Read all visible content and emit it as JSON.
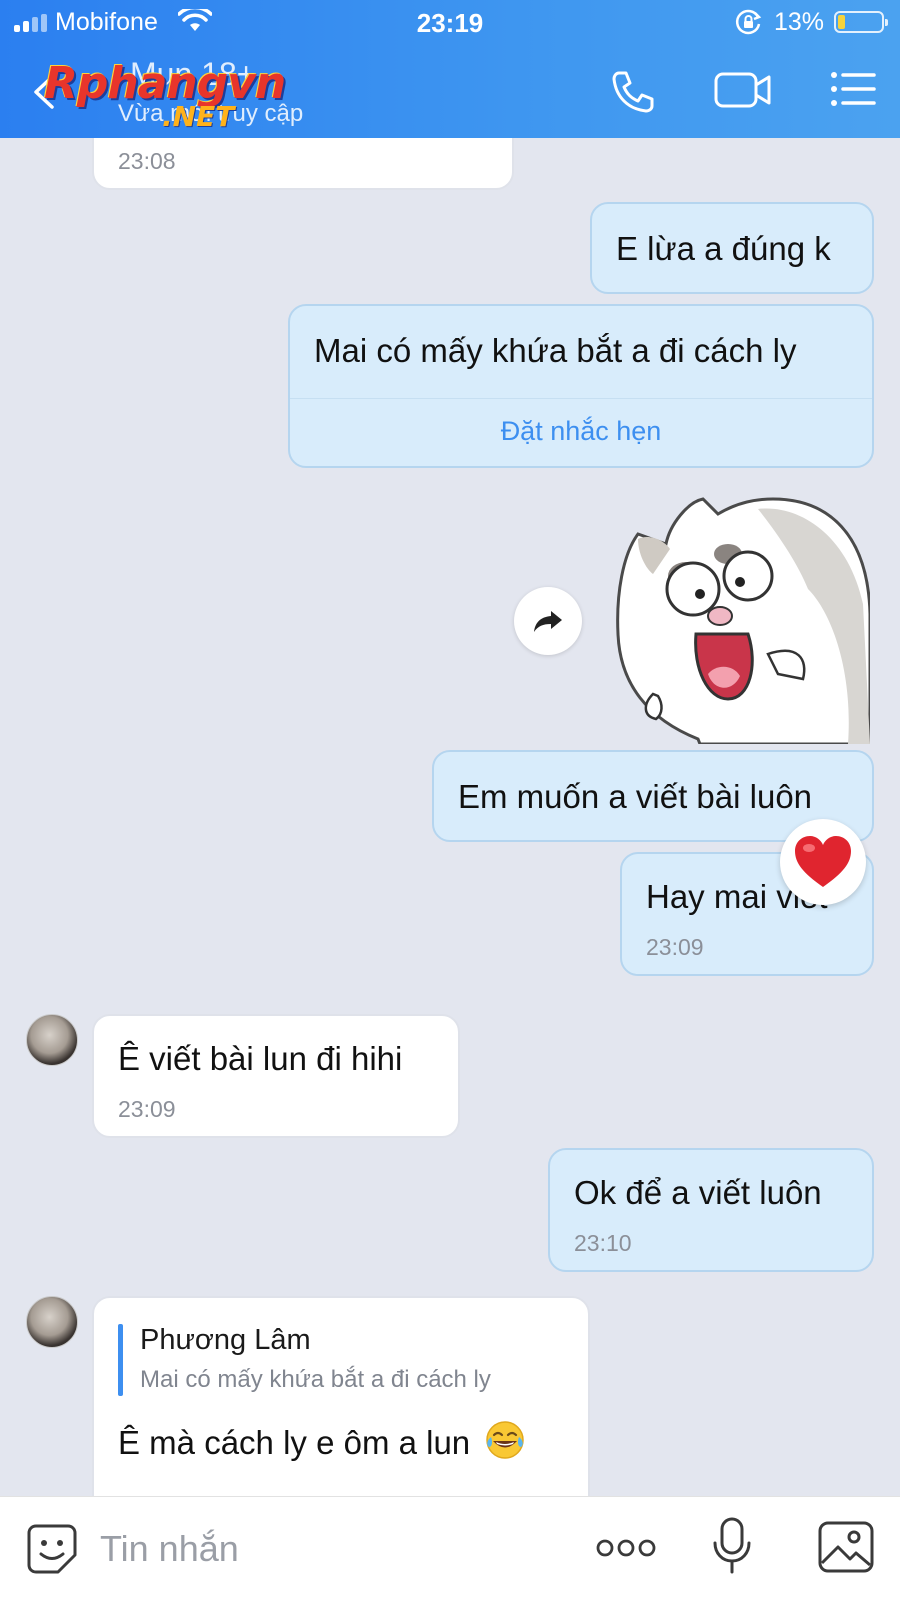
{
  "status_bar": {
    "carrier": "Mobifone",
    "time": "23:19",
    "battery_percent": "13%",
    "battery_level": 0.13,
    "icons": [
      "signal-icon",
      "wifi-icon",
      "rotation-lock-icon",
      "battery-icon"
    ]
  },
  "header": {
    "contact_name": "Mun 18+",
    "contact_status": "Vừa mới truy cập",
    "watermark_main": "Rphangvn",
    "watermark_sub": ".NET",
    "icons": [
      "back-chevron-icon",
      "phone-icon",
      "video-call-icon",
      "menu-icon"
    ]
  },
  "messages": [
    {
      "direction": "in",
      "time": "23:08"
    },
    {
      "direction": "out",
      "text": "E lừa a đúng k"
    },
    {
      "direction": "out",
      "text": "Mai có mấy khứa bắt a đi cách ly",
      "action": "Đặt nhắc hẹn"
    },
    {
      "direction": "out",
      "type": "sticker",
      "sticker": "screaming-cat-sticker"
    },
    {
      "direction": "out",
      "text": "Em muốn a viết bài luôn",
      "reaction": "heart"
    },
    {
      "direction": "out",
      "text": "Hay mai viết",
      "time": "23:09"
    },
    {
      "direction": "in",
      "text": "Ê viết bài lun đi hihi",
      "time": "23:09"
    },
    {
      "direction": "out",
      "text": "Ok để a viết luôn",
      "time": "23:10"
    },
    {
      "direction": "in",
      "reply_to": {
        "name": "Phương Lâm",
        "text": "Mai có mấy khứa bắt a đi cách ly"
      },
      "text": "Ê mà cách ly e ôm a lun",
      "emoji": "tears-of-joy"
    }
  ],
  "colors": {
    "header_start": "#2b7ff0",
    "header_end": "#4ba2f0",
    "outgoing_bubble": "#d8ecfb",
    "incoming_bubble": "#ffffff",
    "chat_background": "#e3e6ef",
    "link": "#3d8ff0"
  },
  "input_bar": {
    "placeholder": "Tin nhắn",
    "icons": [
      "sticker-icon",
      "more-icon",
      "microphone-icon",
      "image-icon"
    ]
  }
}
